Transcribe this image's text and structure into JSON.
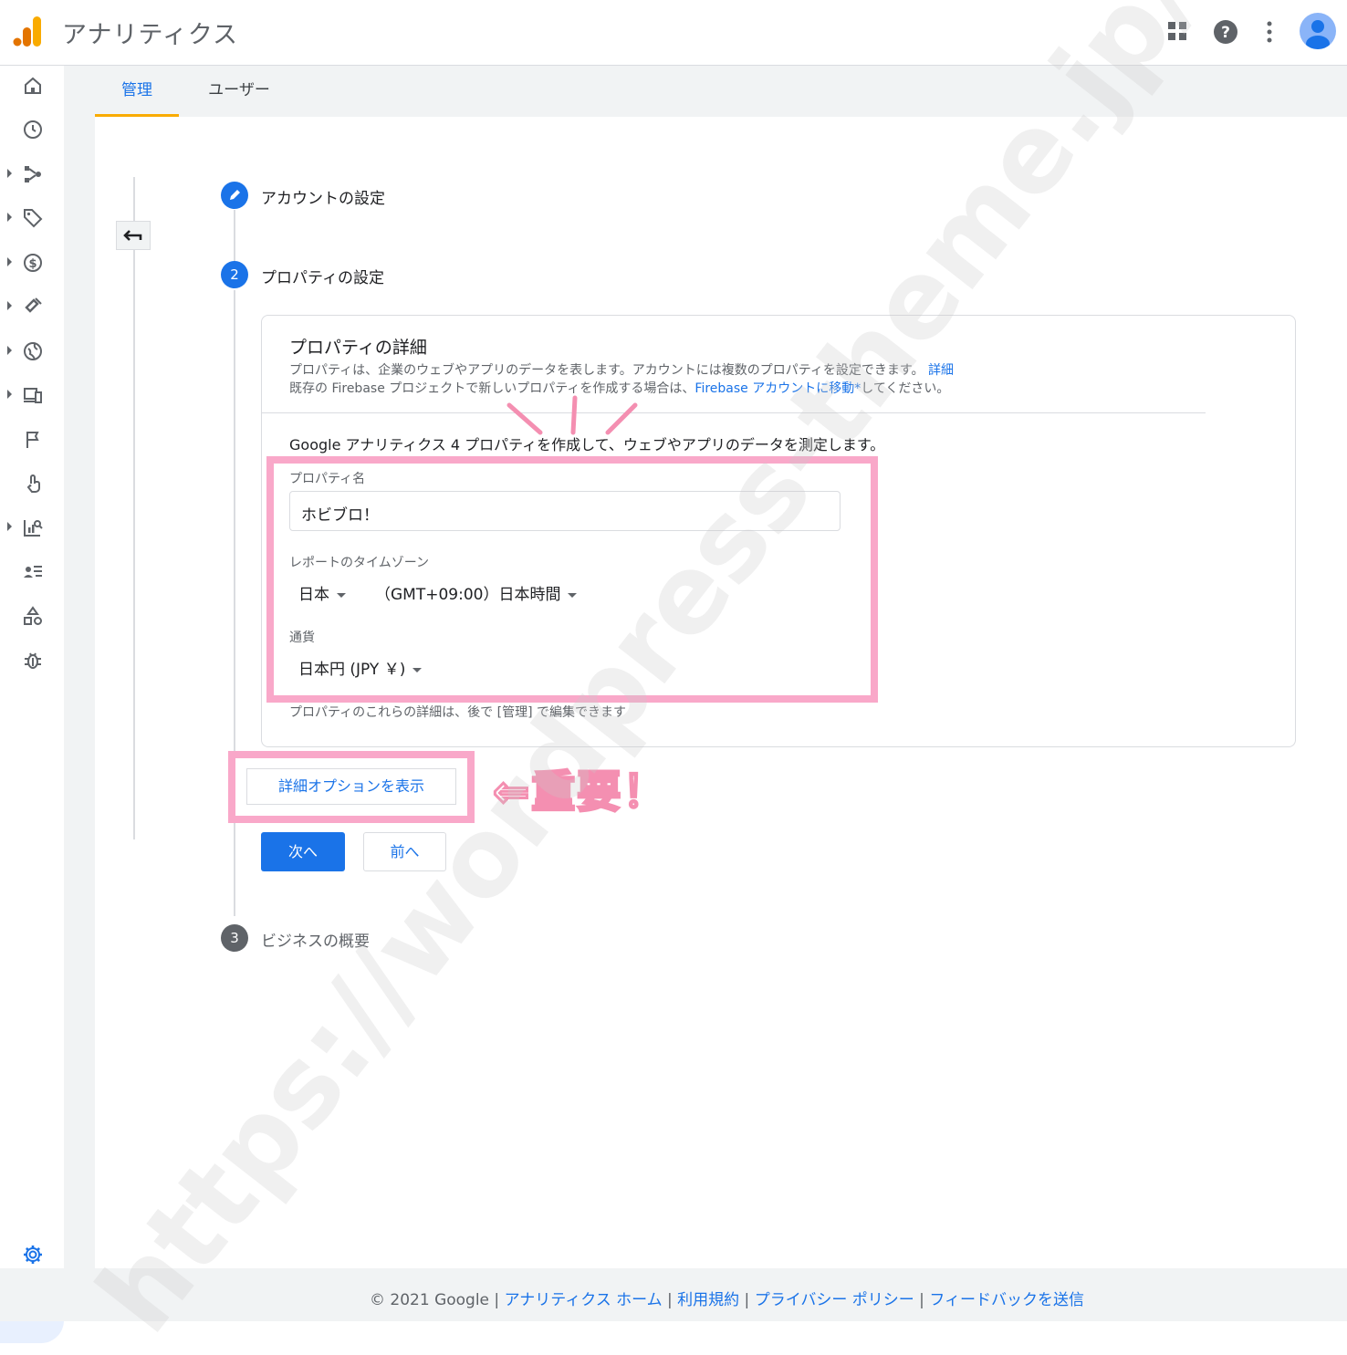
{
  "header": {
    "app_title": "アナリティクス",
    "icons": [
      "apps-grid-icon",
      "help-icon",
      "more-vert-icon",
      "account-avatar-icon"
    ]
  },
  "tabs": [
    {
      "label": "管理",
      "active": true
    },
    {
      "label": "ユーザー",
      "active": false
    }
  ],
  "left_nav": [
    "home-icon",
    "clock-icon",
    "explore-icon",
    "tag-icon",
    "dollar-icon",
    "magnet-icon",
    "globe-icon",
    "devices-icon",
    "flag-icon",
    "touch-icon",
    "report-icon",
    "audience-icon",
    "shapes-icon",
    "debug-icon",
    "settings-icon",
    "expand-icon"
  ],
  "steps": [
    {
      "number": "",
      "label": "アカウントの設定",
      "state": "completed"
    },
    {
      "number": "2",
      "label": "プロパティの設定",
      "state": "active"
    },
    {
      "number": "3",
      "label": "ビジネスの概要",
      "state": "pending"
    }
  ],
  "card": {
    "title": "プロパティの詳細",
    "desc_line1": "プロパティは、企業のウェブやアプリのデータを表します。アカウントには複数のプロパティを設定できます。",
    "desc_link1": "詳細",
    "desc_line2_prefix": "既存の Firebase プロジェクトで新しいプロパティを作成する場合は、",
    "desc_link2": "Firebase アカウントに移動*",
    "desc_line2_suffix": "してください。",
    "intro": "Google アナリティクス 4 プロパティを作成して、ウェブやアプリのデータを測定します。",
    "property_name_label": "プロパティ名",
    "property_name_value": "ホビブロ！",
    "timezone_label": "レポートのタイムゾーン",
    "timezone_country": "日本",
    "timezone_value": "（GMT+09:00）日本時間",
    "currency_label": "通貨",
    "currency_value": "日本円 (JPY ￥)",
    "note": "プロパティのこれらの詳細は、後で [管理] で編集できます"
  },
  "buttons": {
    "advanced": "詳細オプションを表示",
    "next": "次へ",
    "prev": "前へ",
    "back": "back-arrow-icon"
  },
  "annotation": {
    "important": "⇐重要！",
    "color": "#f9a8c9"
  },
  "footer": {
    "copyright": "© 2021 Google",
    "links": [
      "アナリティクス ホーム",
      "利用規約",
      "プライバシー ポリシー",
      "フィードバックを送信"
    ]
  },
  "watermark": "https://wordpress-theme.jp/affinger/",
  "colors": {
    "accent": "#1a73e8",
    "tab_underline": "#f9ab00",
    "annotation": "#f9a8c9"
  }
}
